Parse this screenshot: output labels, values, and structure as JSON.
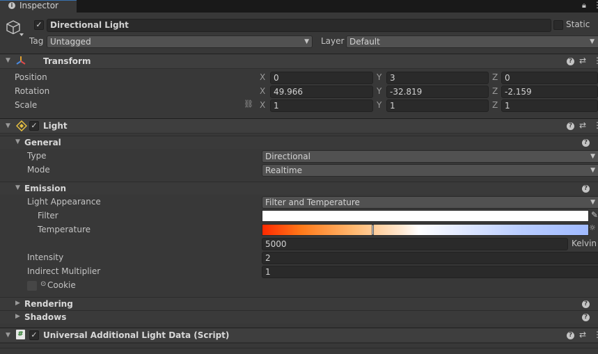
{
  "tab": {
    "title": "Inspector",
    "icon": "info-icon"
  },
  "gameobject": {
    "name": "Directional Light",
    "active": true,
    "static_label": "Static",
    "tag_label": "Tag",
    "tag_value": "Untagged",
    "layer_label": "Layer",
    "layer_value": "Default"
  },
  "transform": {
    "title": "Transform",
    "rows": [
      {
        "label": "Position",
        "x": "0",
        "y": "3",
        "z": "0"
      },
      {
        "label": "Rotation",
        "x": "49.966",
        "y": "-32.819",
        "z": "-2.159"
      },
      {
        "label": "Scale",
        "x": "1",
        "y": "1",
        "z": "1"
      }
    ],
    "axis": {
      "x": "X",
      "y": "Y",
      "z": "Z"
    }
  },
  "light": {
    "title": "Light",
    "enabled": true,
    "general": {
      "title": "General",
      "type_label": "Type",
      "type_value": "Directional",
      "mode_label": "Mode",
      "mode_value": "Realtime"
    },
    "emission": {
      "title": "Emission",
      "appearance_label": "Light Appearance",
      "appearance_value": "Filter and Temperature",
      "filter_label": "Filter",
      "filter_color": "#ffffff",
      "temperature_label": "Temperature",
      "temperature_value": "5000",
      "temperature_unit": "Kelvin",
      "intensity_label": "Intensity",
      "intensity_value": "2",
      "indirect_label": "Indirect Multiplier",
      "indirect_value": "1",
      "cookie_label": "Cookie"
    },
    "rendering_title": "Rendering",
    "shadows_title": "Shadows"
  },
  "script_component": {
    "title": "Universal Additional Light Data (Script)",
    "enabled": true
  },
  "colors": {
    "background": "#383838",
    "field": "#2a2a2a",
    "accent": "#3a72b0"
  }
}
